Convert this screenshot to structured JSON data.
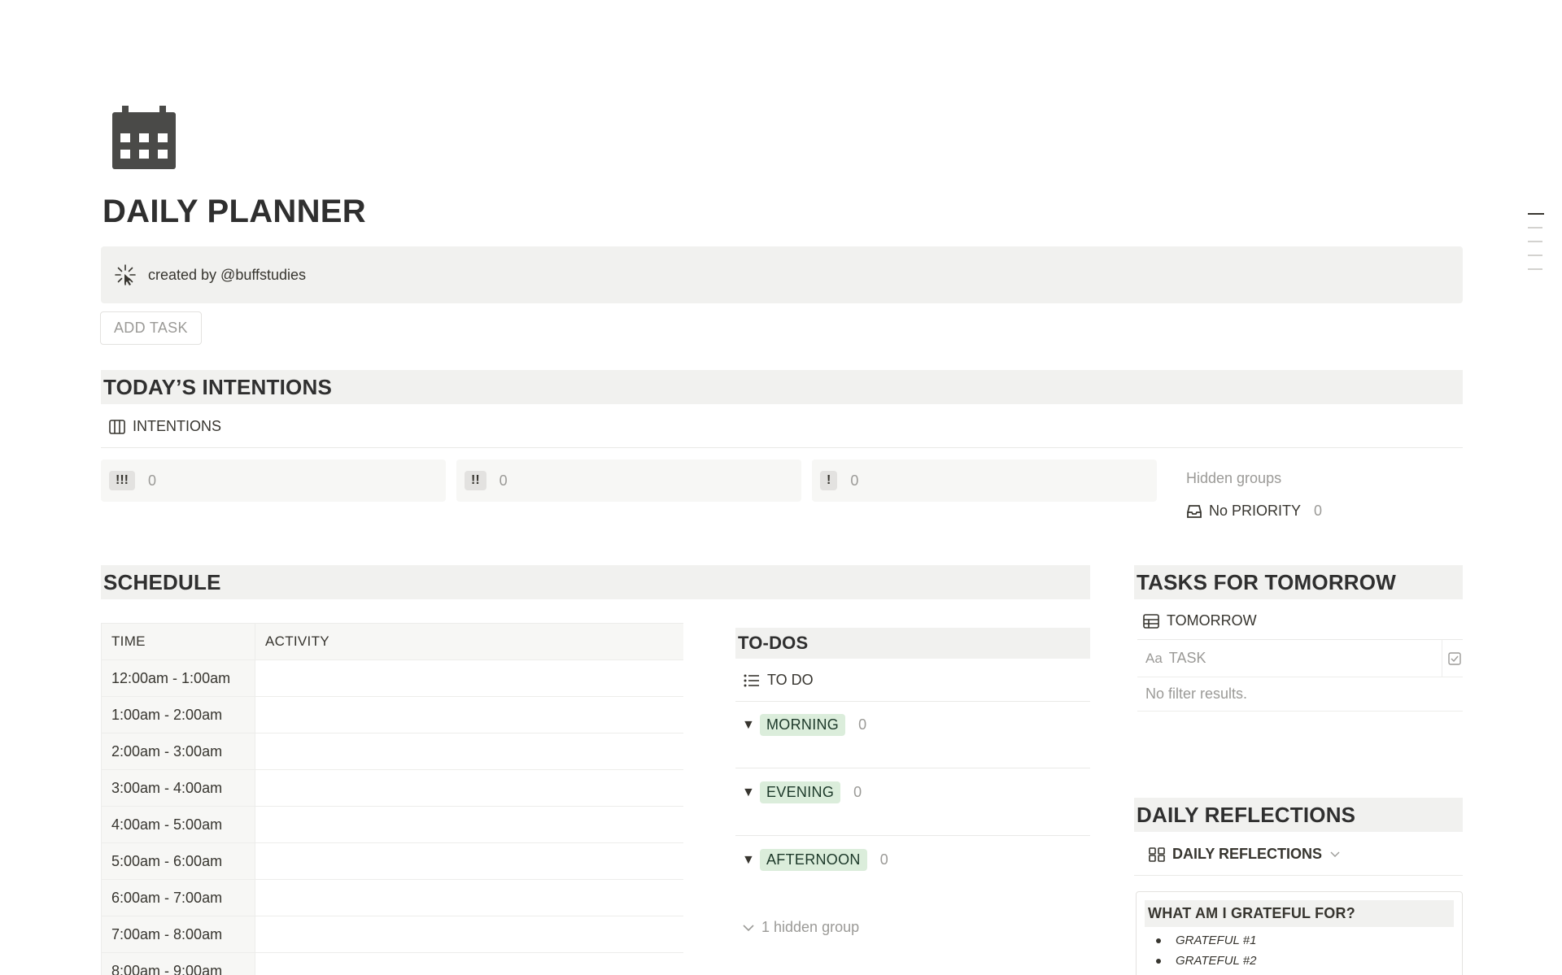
{
  "page": {
    "title": "DAILY PLANNER",
    "icon": "calendar-icon"
  },
  "callout": {
    "icon": "sparkle-cursor-icon",
    "text": "created by @buffstudies"
  },
  "add_task_button": "ADD TASK",
  "intentions": {
    "heading": "TODAY’S INTENTIONS",
    "view_label": "INTENTIONS",
    "columns": [
      {
        "label": "!!!",
        "count": "0"
      },
      {
        "label": "!!",
        "count": "0"
      },
      {
        "label": "!",
        "count": "0"
      }
    ],
    "hidden_groups_label": "Hidden groups",
    "hidden_group": {
      "label": "No PRIORITY",
      "count": "0"
    }
  },
  "schedule": {
    "heading": "SCHEDULE",
    "columns": [
      "TIME",
      "ACTIVITY"
    ],
    "rows": [
      "12:00am - 1:00am",
      "1:00am - 2:00am",
      "2:00am - 3:00am",
      "3:00am - 4:00am",
      "4:00am - 5:00am",
      "5:00am - 6:00am",
      "6:00am - 7:00am",
      "7:00am - 8:00am",
      "8:00am - 9:00am"
    ]
  },
  "todos": {
    "heading": "TO-DOS",
    "view_label": "TO DO",
    "groups": [
      {
        "label": "MORNING",
        "count": "0"
      },
      {
        "label": "EVENING",
        "count": "0"
      },
      {
        "label": "AFTERNOON",
        "count": "0"
      }
    ],
    "hidden_group_label": "1 hidden group"
  },
  "tomorrow": {
    "heading": "TASKS FOR TOMORROW",
    "view_label": "TOMORROW",
    "column_prefix": "Aa",
    "column_label": "TASK",
    "empty_text": "No filter results."
  },
  "reflections": {
    "heading": "DAILY REFLECTIONS",
    "view_label": "DAILY REFLECTIONS",
    "card_title": "WHAT AM I GRATEFUL FOR?",
    "items": [
      "GRATEFUL #1",
      "GRATEFUL #2"
    ]
  }
}
